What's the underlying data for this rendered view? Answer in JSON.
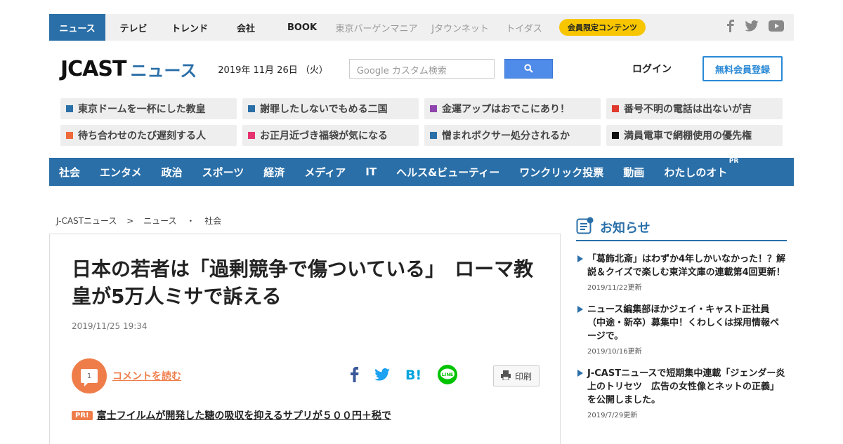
{
  "topnav": {
    "items": [
      "ニュース",
      "テレビ",
      "トレンド",
      "会社",
      "BOOK",
      "東京バーゲンマニア",
      "Jタウンネット",
      "トイダス"
    ],
    "member_label": "会員限定コンテンツ"
  },
  "header": {
    "logo_j": "JCAST",
    "logo_news": "ニュース",
    "date": "2019年 11月 26日 （火）",
    "search_placeholder": "Google カスタム検索",
    "login": "ログイン",
    "register": "無料会員登録"
  },
  "trends": [
    {
      "label": "東京ドームを一杯にした教皇",
      "color": "#2a6fa8"
    },
    {
      "label": "謝罪したしないでもめる二国",
      "color": "#2a6fa8"
    },
    {
      "label": "金運アップはおでこにあり！",
      "color": "#8e44ad"
    },
    {
      "label": "番号不明の電話は出ないが吉",
      "color": "#e03a2f"
    },
    {
      "label": "待ち合わせのたび遅刻する人",
      "color": "#ef6a3a"
    },
    {
      "label": "お正月近づき福袋が気になる",
      "color": "#e6326e"
    },
    {
      "label": "憎まれボクサー処分されるか",
      "color": "#2a6fa8"
    },
    {
      "label": "満員電車で網棚使用の優先権",
      "color": "#111111"
    }
  ],
  "categories": [
    "社会",
    "エンタメ",
    "政治",
    "スポーツ",
    "経済",
    "メディア",
    "IT",
    "ヘルス&ビューティー",
    "ワンクリック投票",
    "動画",
    "わたしのオト"
  ],
  "category_pr": "PR",
  "breadcrumb": [
    "J-CASTニュース",
    ">",
    "ニュース",
    "・",
    "社会"
  ],
  "article": {
    "title": "日本の若者は「過剰競争で傷ついている」　ローマ教皇が5万人ミサで訴える",
    "date": "2019/11/25 19:34",
    "comment_count": "1",
    "comment_link": "コメントを読む",
    "print_label": "印刷",
    "pr_badge": "PR!",
    "pr_link": "富士フイルムが開発した糖の吸収を抑えるサプリが５００円＋税で"
  },
  "sidebar": {
    "title": "お知らせ",
    "notices": [
      {
        "text": "「葛飾北斎」はわずか4年しかいなかった！？解説＆クイズで楽しむ東洋文庫の連載第4回更新！",
        "date": "2019/11/22更新"
      },
      {
        "text": "ニュース編集部ほかジェイ・キャスト正社員（中途・新卒）募集中！くわしくは採用情報ページで。",
        "date": "2019/10/16更新"
      },
      {
        "text": "J-CASTニュースで短期集中連載「ジェンダー炎上のトリセツ　広告の女性像とネットの正義」を公開しました。",
        "date": "2019/7/29更新"
      }
    ]
  },
  "colors": {
    "brand_blue": "#2a6fa8",
    "accent_orange": "#ef7d4a",
    "member_yellow": "#f7c600"
  }
}
